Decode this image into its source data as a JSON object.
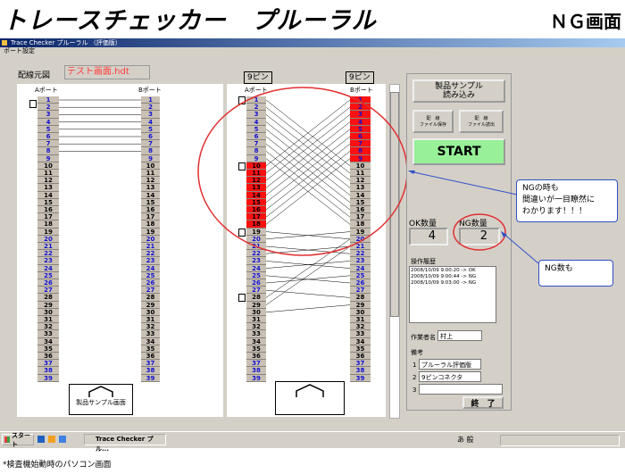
{
  "page_title": "トレースチェッカー　プルーラル",
  "page_title_right": "ＮＧ画面",
  "footer_note": "*検査機始動時のパソコン画面",
  "window": {
    "title": "Trace Checker プルーラル （評価版）",
    "menu": "ポート設定"
  },
  "left_panel": {
    "label": "配線元図",
    "file_name": "テスト画面.hdt",
    "port_a": "Aポート",
    "port_b": "Bポート",
    "sample_label": "製品サンプル画面"
  },
  "right_panel": {
    "pin_label_left": "9ピン",
    "pin_label_right": "9ピン",
    "port_a": "Aポート",
    "port_b": "Bポート"
  },
  "pins": [
    "1",
    "2",
    "3",
    "4",
    "5",
    "6",
    "7",
    "8",
    "9",
    "10",
    "11",
    "12",
    "13",
    "14",
    "15",
    "16",
    "17",
    "18",
    "19",
    "20",
    "21",
    "22",
    "23",
    "24",
    "25",
    "26",
    "27",
    "28",
    "29",
    "30",
    "31",
    "32",
    "33",
    "34",
    "35",
    "36",
    "37",
    "38",
    "39"
  ],
  "pin_colors": {
    "blue": "#1010d0",
    "black": "#000000",
    "red_highlight": "#ff1010"
  },
  "ng_pins_a": [
    "10",
    "11",
    "12",
    "13",
    "14",
    "15",
    "16",
    "17",
    "18"
  ],
  "ng_pins_b": [
    "1",
    "2",
    "3",
    "4",
    "5",
    "6",
    "7",
    "8",
    "9"
  ],
  "buttons": {
    "load_sample": "製品サンプル\n読み込み",
    "save_file": "配　線\nファイル保存",
    "load_file": "配　線\nファイル読出",
    "start": "START",
    "end": "終　了"
  },
  "counts": {
    "ok_label": "OK数量",
    "ok_value": "4",
    "ng_label": "NG数量",
    "ng_value": "2"
  },
  "history": {
    "label": "操作履歴",
    "lines": [
      "2008/10/09 9:00:20 -> OK",
      "2008/10/09 9:00:44 -> NG",
      "2008/10/09 9:03:00 -> NG"
    ]
  },
  "operator": {
    "label": "作業者名",
    "value": "村上"
  },
  "notes": {
    "label": "備考",
    "rows": [
      {
        "num": "1",
        "value": "プルーラル評価版"
      },
      {
        "num": "2",
        "value": "9ピンコネクタ"
      },
      {
        "num": "3",
        "value": ""
      }
    ]
  },
  "callouts": {
    "ng_message": "NGの時も\n間違いが一目瞭然に\nわかります！！！",
    "ng_count": "NG数も"
  },
  "taskbar": {
    "start": "スタート",
    "task": "Trace Checker プル...",
    "tray_text": "あ 般"
  },
  "accent_colors": {
    "start_button": "#98f098",
    "ng_red": "#ff1010",
    "circle_red": "#e03030",
    "arrow_blue": "#3050c8"
  }
}
